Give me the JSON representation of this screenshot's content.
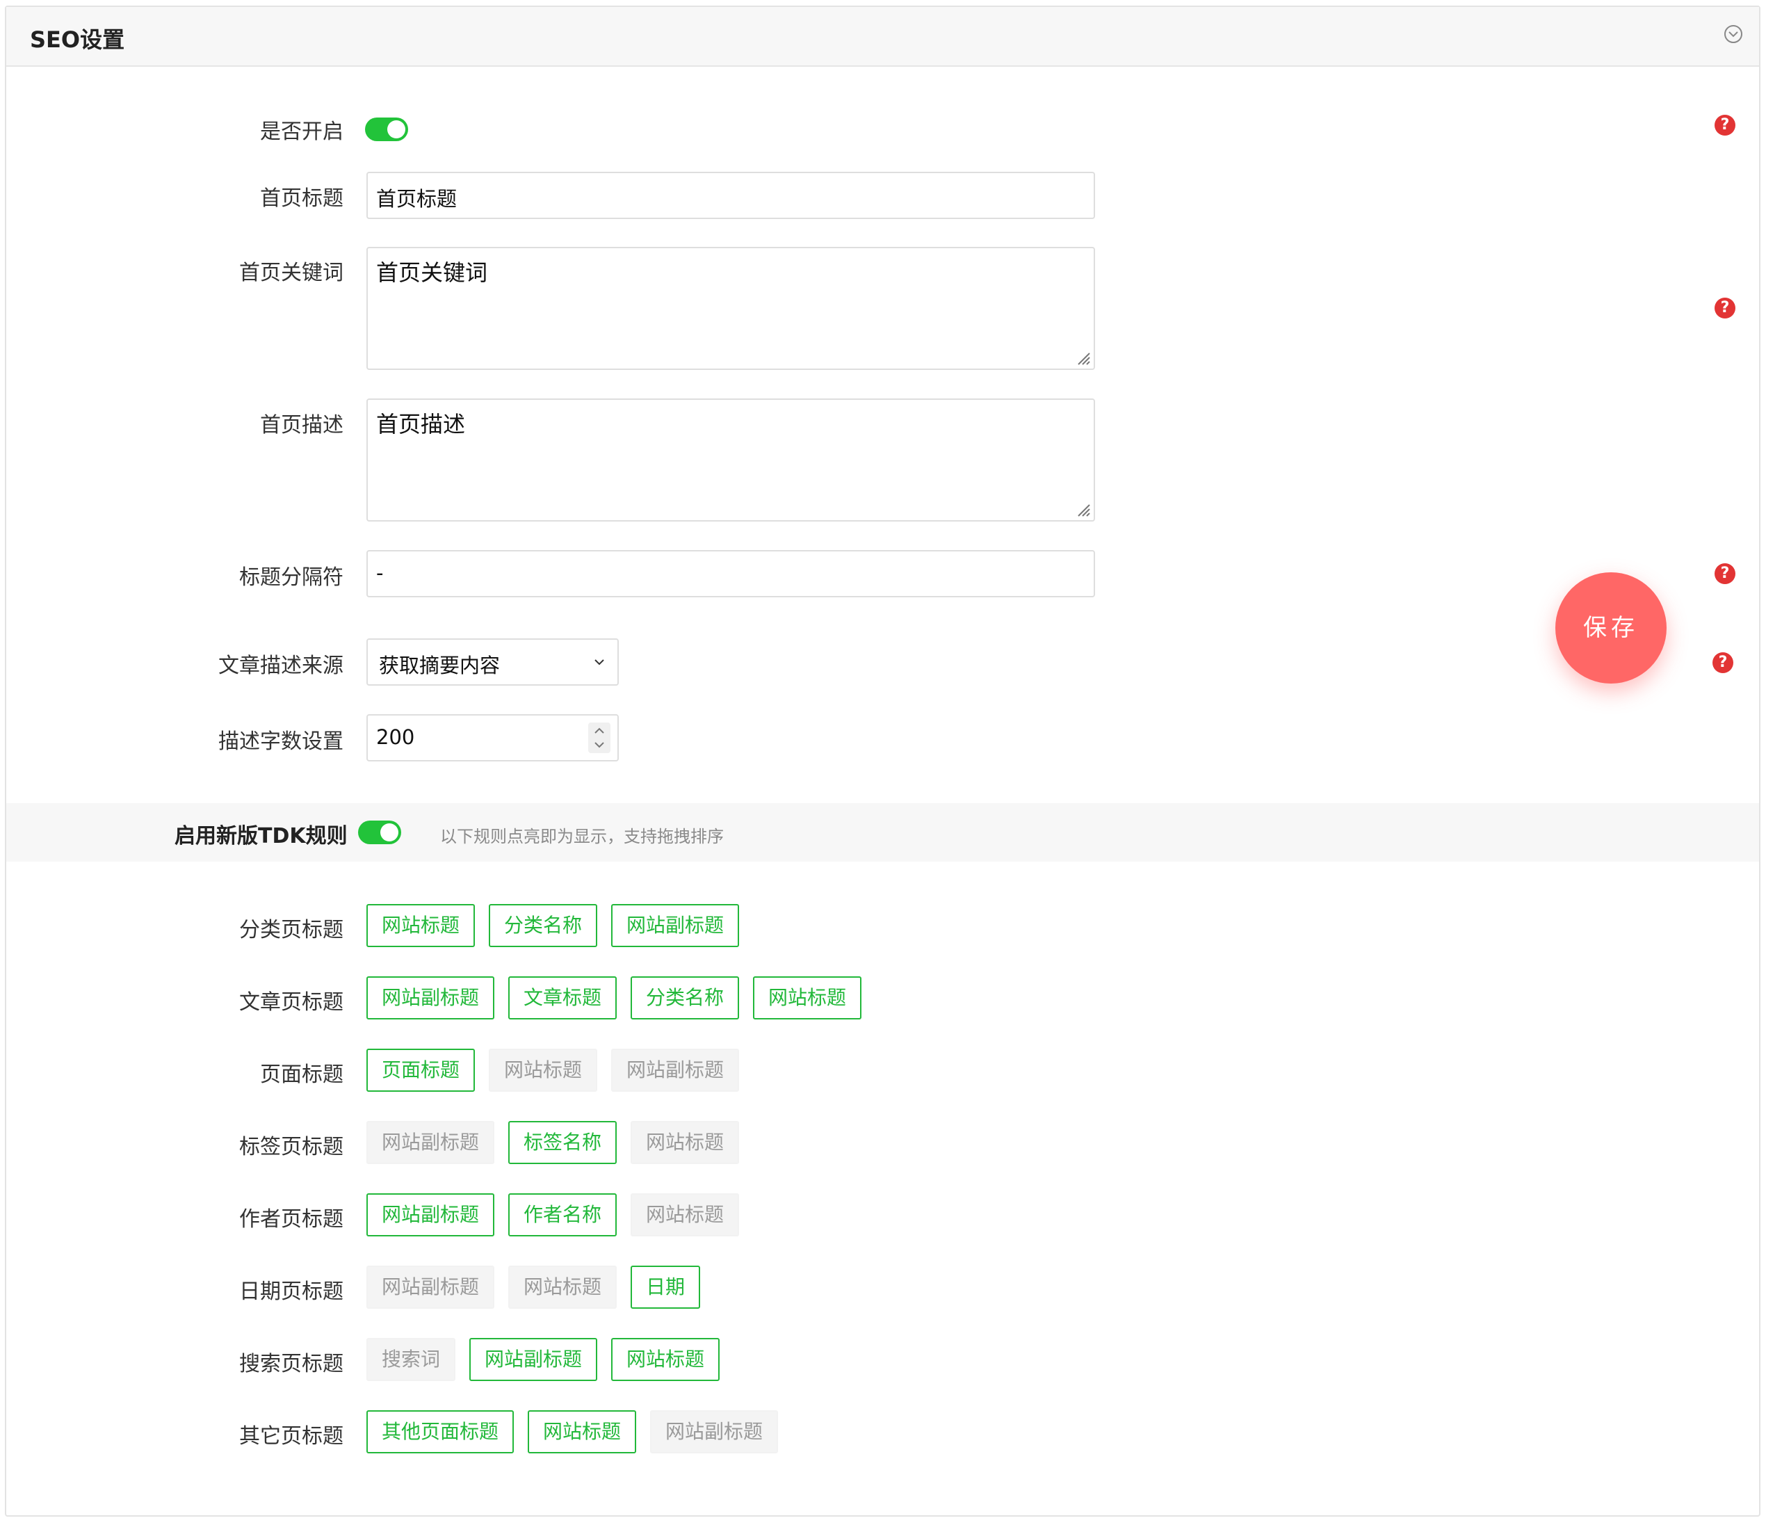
{
  "panel": {
    "title": "SEO设置"
  },
  "fields": {
    "enabled": {
      "label": "是否开启",
      "value": "on"
    },
    "home_title": {
      "label": "首页标题",
      "value": "首页标题"
    },
    "home_keywords": {
      "label": "首页关键词",
      "value": "首页关键词"
    },
    "home_description": {
      "label": "首页描述",
      "value": "首页描述"
    },
    "title_separator": {
      "label": "标题分隔符",
      "value": "-"
    },
    "desc_source": {
      "label": "文章描述来源",
      "value": "获取摘要内容"
    },
    "desc_length": {
      "label": "描述字数设置",
      "value": "200"
    }
  },
  "help_icon": "?",
  "save_button": "保存",
  "tdk": {
    "title": "启用新版TDK规则",
    "enabled": "on",
    "hint": "以下规则点亮即为显示，支持拖拽排序",
    "rules": [
      {
        "label": "分类页标题",
        "chips": [
          {
            "text": "网站标题",
            "on": true
          },
          {
            "text": "分类名称",
            "on": true
          },
          {
            "text": "网站副标题",
            "on": true
          }
        ]
      },
      {
        "label": "文章页标题",
        "chips": [
          {
            "text": "网站副标题",
            "on": true
          },
          {
            "text": "文章标题",
            "on": true
          },
          {
            "text": "分类名称",
            "on": true
          },
          {
            "text": "网站标题",
            "on": true
          }
        ]
      },
      {
        "label": "页面标题",
        "chips": [
          {
            "text": "页面标题",
            "on": true
          },
          {
            "text": "网站标题",
            "on": false
          },
          {
            "text": "网站副标题",
            "on": false
          }
        ]
      },
      {
        "label": "标签页标题",
        "chips": [
          {
            "text": "网站副标题",
            "on": false
          },
          {
            "text": "标签名称",
            "on": true
          },
          {
            "text": "网站标题",
            "on": false
          }
        ]
      },
      {
        "label": "作者页标题",
        "chips": [
          {
            "text": "网站副标题",
            "on": true
          },
          {
            "text": "作者名称",
            "on": true
          },
          {
            "text": "网站标题",
            "on": false
          }
        ]
      },
      {
        "label": "日期页标题",
        "chips": [
          {
            "text": "网站副标题",
            "on": false
          },
          {
            "text": "网站标题",
            "on": false
          },
          {
            "text": "日期",
            "on": true
          }
        ]
      },
      {
        "label": "搜索页标题",
        "chips": [
          {
            "text": "搜索词",
            "on": false
          },
          {
            "text": "网站副标题",
            "on": true
          },
          {
            "text": "网站标题",
            "on": true
          }
        ]
      },
      {
        "label": "其它页标题",
        "chips": [
          {
            "text": "其他页面标题",
            "on": true
          },
          {
            "text": "网站标题",
            "on": true
          },
          {
            "text": "网站副标题",
            "on": false
          }
        ]
      }
    ]
  },
  "colors": {
    "accent_green": "#22b83a",
    "save_red": "#ff6766",
    "help_red": "#e23434"
  },
  "icons": {
    "collapse": "chevron-down-circle-icon",
    "help": "question-icon",
    "select": "chevron-down-icon",
    "stepper": "stepper-icon"
  }
}
